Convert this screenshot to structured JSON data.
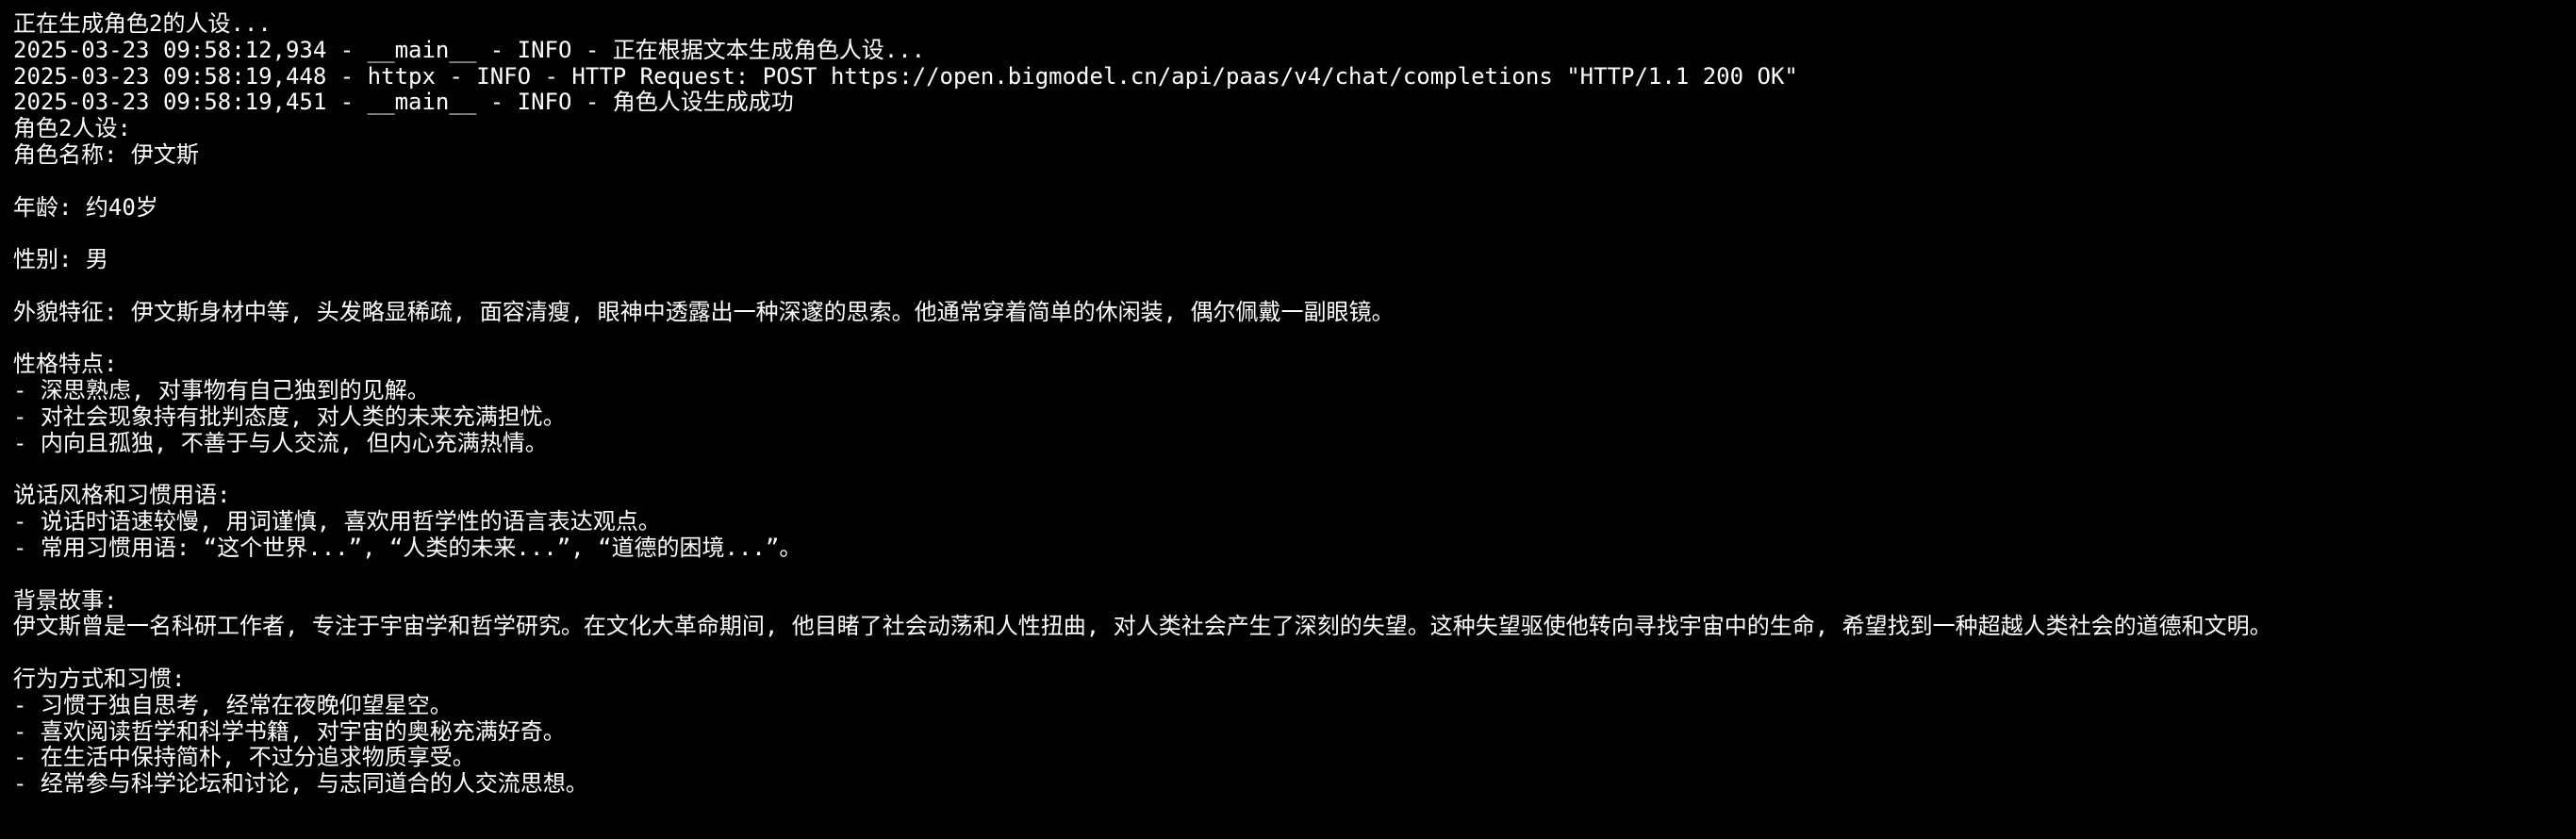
{
  "theme": {
    "background": "#000000",
    "foreground": "#ffffff"
  },
  "terminal": {
    "lines": [
      "正在生成角色2的人设...",
      "2025-03-23 09:58:12,934 - __main__ - INFO - 正在根据文本生成角色人设...",
      "2025-03-23 09:58:19,448 - httpx - INFO - HTTP Request: POST https://open.bigmodel.cn/api/paas/v4/chat/completions \"HTTP/1.1 200 OK\"",
      "2025-03-23 09:58:19,451 - __main__ - INFO - 角色人设生成成功",
      "角色2人设:",
      "角色名称: 伊文斯",
      "",
      "年龄: 约40岁",
      "",
      "性别: 男",
      "",
      "外貌特征: 伊文斯身材中等, 头发略显稀疏, 面容清瘦, 眼神中透露出一种深邃的思索。他通常穿着简单的休闲装, 偶尔佩戴一副眼镜。",
      "",
      "性格特点:",
      "- 深思熟虑, 对事物有自己独到的见解。",
      "- 对社会现象持有批判态度, 对人类的未来充满担忧。",
      "- 内向且孤独, 不善于与人交流, 但内心充满热情。",
      "",
      "说话风格和习惯用语:",
      "- 说话时语速较慢, 用词谨慎, 喜欢用哲学性的语言表达观点。",
      "- 常用习惯用语: “这个世界...”, “人类的未来...”, “道德的困境...”。",
      "",
      "背景故事:",
      "伊文斯曾是一名科研工作者, 专注于宇宙学和哲学研究。在文化大革命期间, 他目睹了社会动荡和人性扭曲, 对人类社会产生了深刻的失望。这种失望驱使他转向寻找宇宙中的生命, 希望找到一种超越人类社会的道德和文明。",
      "",
      "行为方式和习惯:",
      "- 习惯于独自思考, 经常在夜晚仰望星空。",
      "- 喜欢阅读哲学和科学书籍, 对宇宙的奥秘充满好奇。",
      "- 在生活中保持简朴, 不过分追求物质享受。",
      "- 经常参与科学论坛和讨论, 与志同道合的人交流思想。"
    ]
  }
}
